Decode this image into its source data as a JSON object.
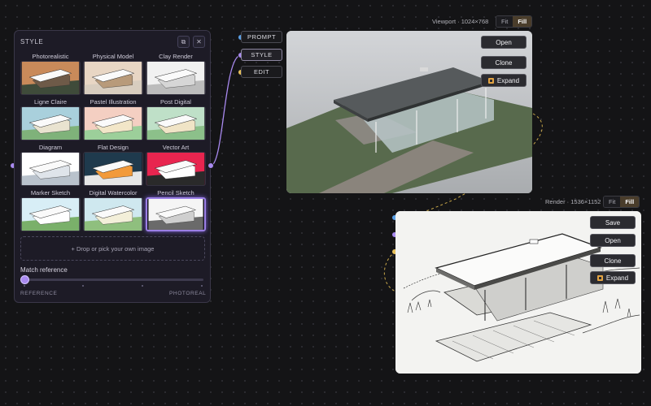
{
  "style_panel": {
    "title": "STYLE",
    "copy_icon": "⧉",
    "close_icon": "✕",
    "styles": [
      {
        "label": "Photorealistic"
      },
      {
        "label": "Physical Model"
      },
      {
        "label": "Clay Render"
      },
      {
        "label": "Ligne Claire"
      },
      {
        "label": "Pastel Illustration"
      },
      {
        "label": "Post Digital"
      },
      {
        "label": "Diagram"
      },
      {
        "label": "Flat Design"
      },
      {
        "label": "Vector Art"
      },
      {
        "label": "Marker Sketch"
      },
      {
        "label": "Digital Watercolor"
      },
      {
        "label": "Pencil Sketch"
      }
    ],
    "selected_style": "Pencil Sketch",
    "drop_zone": "+ Drop or pick your own image",
    "match_label": "Match reference",
    "slider": {
      "min_label": "REFERENCE",
      "max_label": "PHOTOREAL",
      "value": 0
    }
  },
  "nodes": {
    "prompt": "PROMPT",
    "style": "STYLE",
    "edit": "EDIT"
  },
  "viewport": {
    "header": "Viewport · 1024×768",
    "fit": "Fit",
    "fill": "Fill",
    "active": "Fill",
    "buttons": {
      "open": "Open",
      "clone": "Clone",
      "expand": "Expand"
    }
  },
  "render": {
    "header": "Render · 1536×1152",
    "fit": "Fit",
    "fill": "Fill",
    "active": "Fill",
    "buttons": {
      "save": "Save",
      "open": "Open",
      "clone": "Clone",
      "expand": "Expand"
    }
  },
  "colors": {
    "accent_purple": "#9b7fe6",
    "port_blue": "#5aa0e6",
    "port_purple": "#a98af0",
    "port_yellow": "#e8c15a",
    "fill_active": "#4a3d2b",
    "wire_yellow": "#c9a84a"
  }
}
